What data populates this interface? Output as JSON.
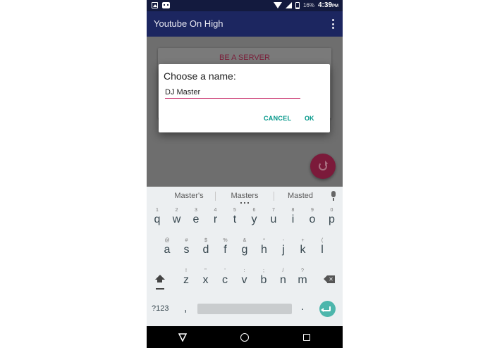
{
  "status_bar": {
    "battery": "16%",
    "time": "4:39",
    "time_suffix": "PM"
  },
  "app_bar": {
    "title": "Youtube On High"
  },
  "content": {
    "server_card_title": "BE A SERVER"
  },
  "dialog": {
    "title": "Choose a name:",
    "input_value": "DJ Master",
    "cancel_label": "CANCEL",
    "ok_label": "OK"
  },
  "keyboard": {
    "suggestions": [
      "Master's",
      "Masters",
      "Masted"
    ],
    "row1": [
      {
        "hint": "1",
        "key": "q"
      },
      {
        "hint": "2",
        "key": "w"
      },
      {
        "hint": "3",
        "key": "e"
      },
      {
        "hint": "4",
        "key": "r"
      },
      {
        "hint": "5",
        "key": "t"
      },
      {
        "hint": "6",
        "key": "y"
      },
      {
        "hint": "7",
        "key": "u"
      },
      {
        "hint": "8",
        "key": "i"
      },
      {
        "hint": "9",
        "key": "o"
      },
      {
        "hint": "0",
        "key": "p"
      }
    ],
    "row2": [
      {
        "hint": "@",
        "key": "a"
      },
      {
        "hint": "#",
        "key": "s"
      },
      {
        "hint": "$",
        "key": "d"
      },
      {
        "hint": "%",
        "key": "f"
      },
      {
        "hint": "&",
        "key": "g"
      },
      {
        "hint": "*",
        "key": "h"
      },
      {
        "hint": "-",
        "key": "j"
      },
      {
        "hint": "+",
        "key": "k"
      },
      {
        "hint": "(",
        "key": "l"
      }
    ],
    "row3": [
      {
        "hint": "!",
        "key": "z"
      },
      {
        "hint": "\"",
        "key": "x"
      },
      {
        "hint": "'",
        "key": "c"
      },
      {
        "hint": ":",
        "key": "v"
      },
      {
        "hint": ";",
        "key": "b"
      },
      {
        "hint": "/",
        "key": "n"
      },
      {
        "hint": "?",
        "key": "m"
      }
    ],
    "symbols_label": "?123",
    "comma": ",",
    "period": "."
  },
  "colors": {
    "status_bar": "#131a3e",
    "app_bar": "#1c2660",
    "accent": "#c2185b",
    "dialog_button": "#009688",
    "enter_key": "#4db6ac"
  }
}
